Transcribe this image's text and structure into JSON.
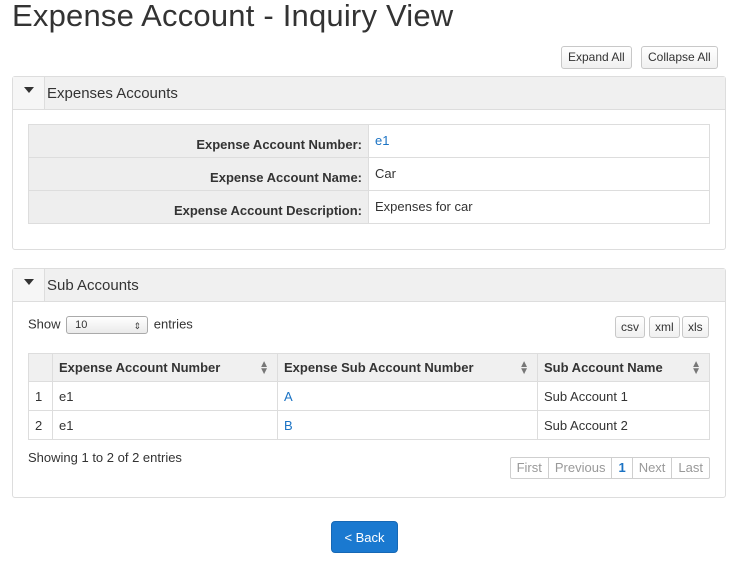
{
  "page": {
    "title": "Expense Account - Inquiry View"
  },
  "toolbar": {
    "expand_all": "Expand All",
    "collapse_all": "Collapse All"
  },
  "accounts_panel": {
    "title": "Expenses Accounts",
    "fields": [
      {
        "label": "Expense Account Number:",
        "value": "e1"
      },
      {
        "label": "Expense Account Name:",
        "value": "Car"
      },
      {
        "label": "Expense Account Description:",
        "value": "Expenses for car"
      }
    ]
  },
  "sub_panel": {
    "title": "Sub Accounts",
    "show_label": "Show",
    "entries_label": "entries",
    "page_size": "10",
    "export_buttons": [
      "csv",
      "xml",
      "xls"
    ],
    "columns": [
      "Expense Account Number",
      "Expense Sub Account Number",
      "Sub Account Name"
    ],
    "rows": [
      {
        "index": "1",
        "account": "e1",
        "sub_account": "A",
        "name": "Sub Account 1"
      },
      {
        "index": "2",
        "account": "e1",
        "sub_account": "B",
        "name": "Sub Account 2"
      }
    ],
    "info": "Showing 1 to 2 of 2 entries",
    "pager": {
      "first": "First",
      "previous": "Previous",
      "current": "1",
      "next": "Next",
      "last": "Last"
    }
  },
  "footer": {
    "back_label": "< Back"
  },
  "colors": {
    "accent": "#1a79d0",
    "link": "#1b73c4",
    "header_bg": "#f0f0f0"
  },
  "icons": [
    "caret-down-icon",
    "sort-icon",
    "select-arrow-icon"
  ]
}
